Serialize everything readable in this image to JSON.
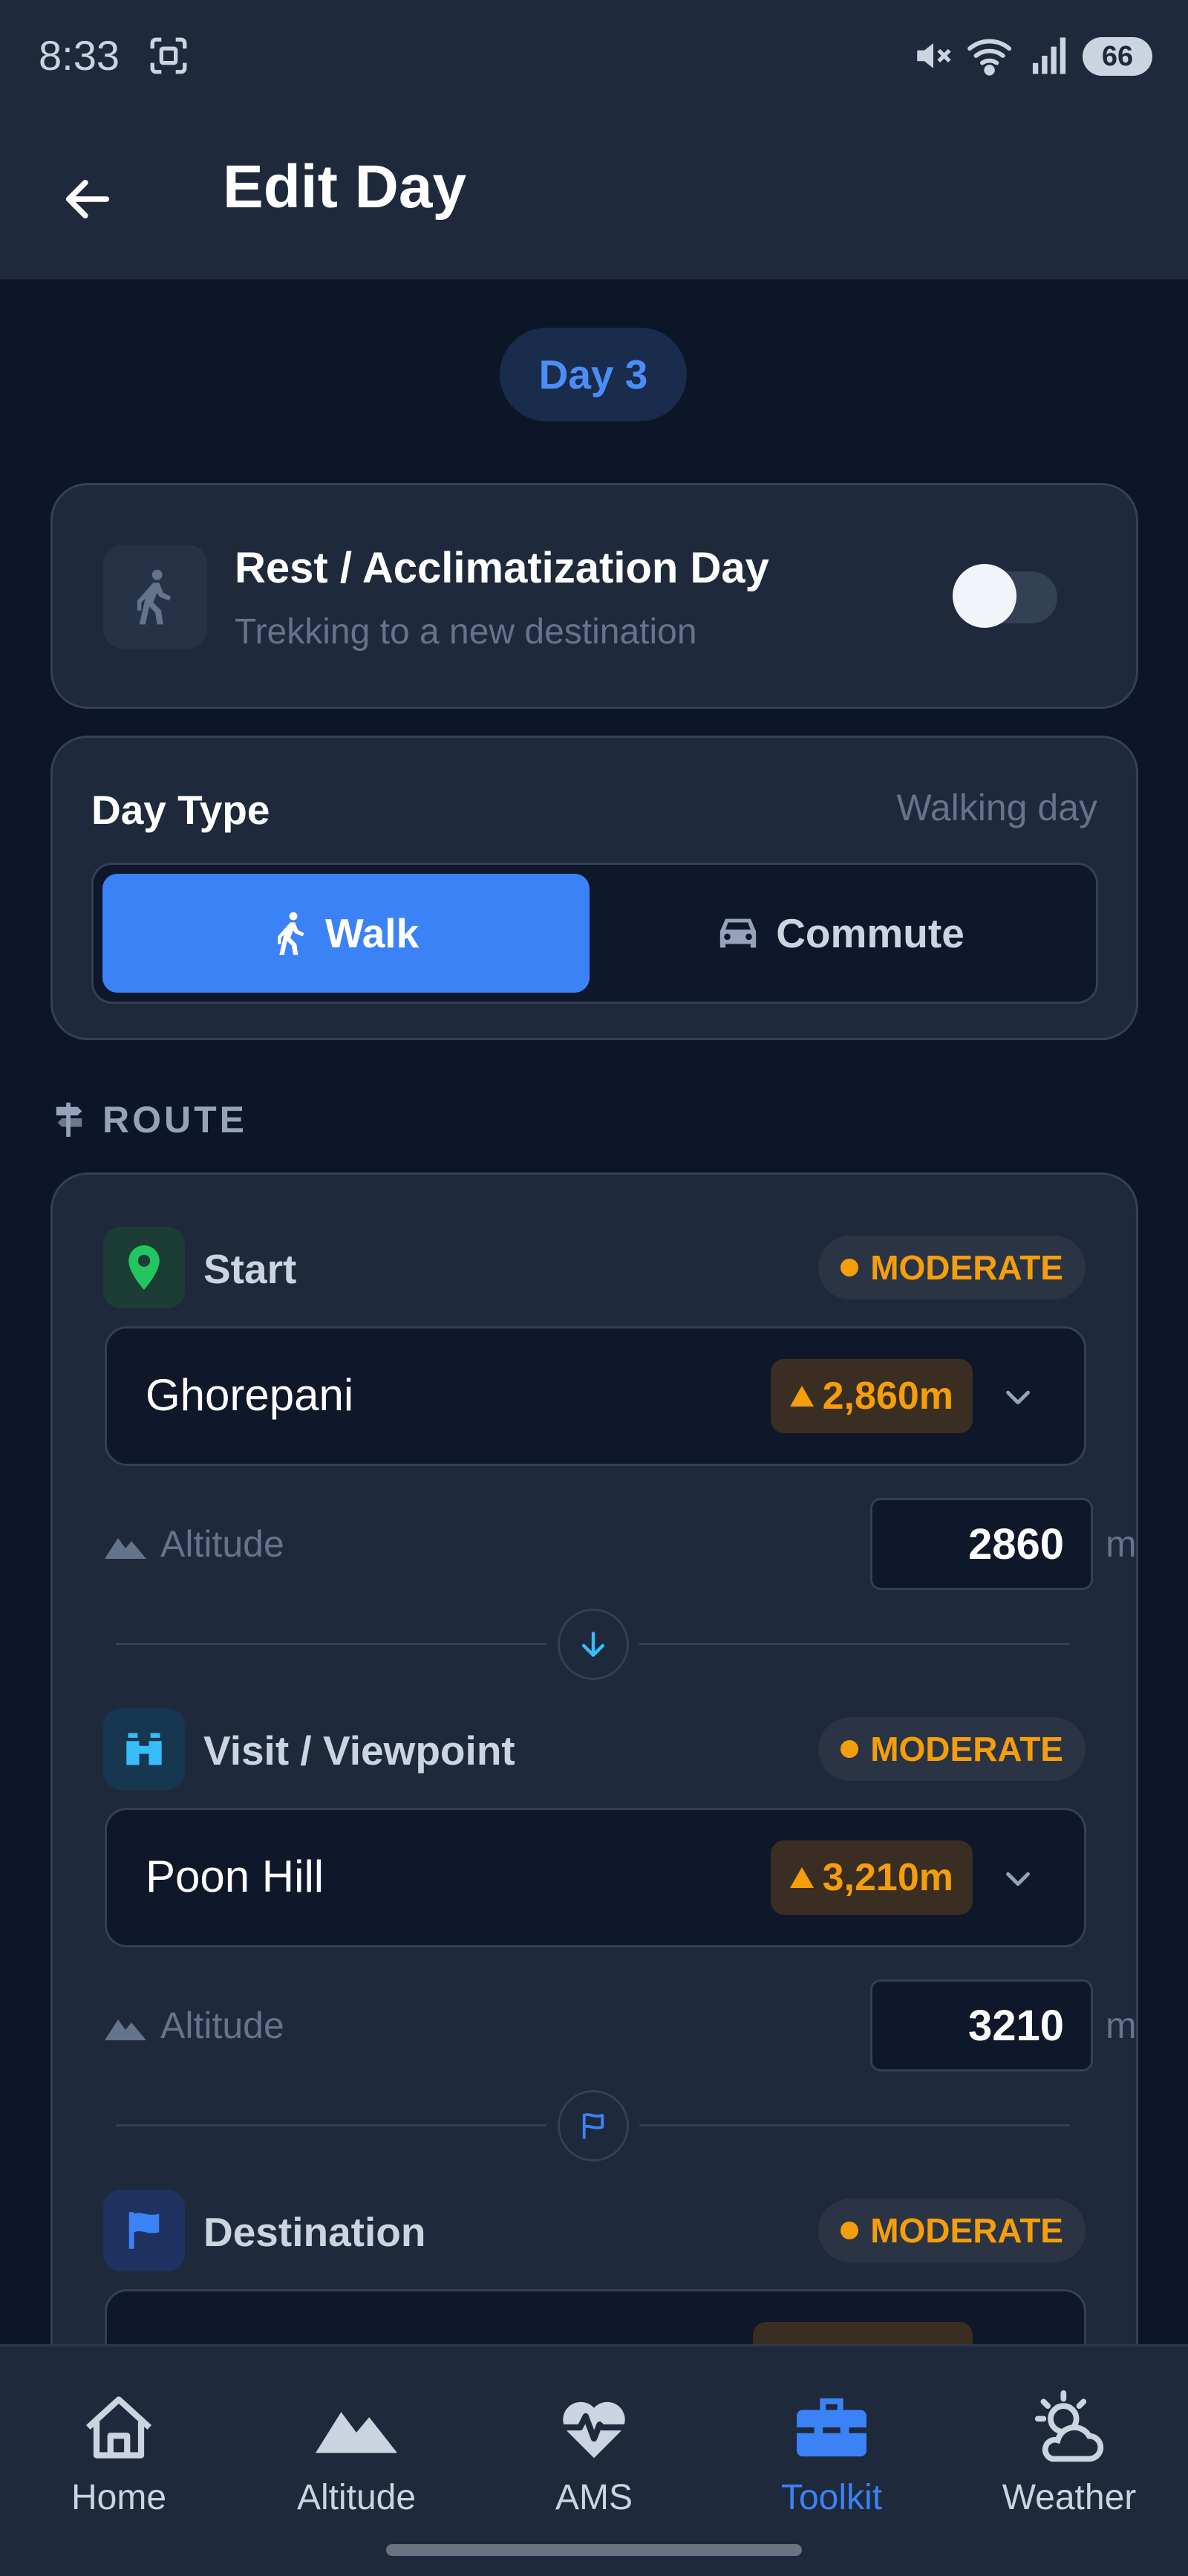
{
  "status_bar": {
    "time": "8:33",
    "battery": "66"
  },
  "header": {
    "title": "Edit Day"
  },
  "day_pill": "Day 3",
  "rest_card": {
    "title": "Rest / Acclimatization Day",
    "subtitle": "Trekking to a new destination",
    "enabled": false
  },
  "day_type": {
    "label": "Day Type",
    "value": "Walking day",
    "options": [
      {
        "label": "Walk",
        "selected": true
      },
      {
        "label": "Commute",
        "selected": false
      }
    ]
  },
  "route": {
    "heading": "ROUTE",
    "stops": [
      {
        "label": "Start",
        "difficulty": "MODERATE",
        "location": "Ghorepani",
        "altitude_chip": "2,860m",
        "altitude_label": "Altitude",
        "altitude_value": "2860",
        "unit": "m"
      },
      {
        "label": "Visit / Viewpoint",
        "difficulty": "MODERATE",
        "location": "Poon Hill",
        "altitude_chip": "3,210m",
        "altitude_label": "Altitude",
        "altitude_value": "3210",
        "unit": "m"
      },
      {
        "label": "Destination",
        "difficulty": "MODERATE"
      }
    ]
  },
  "bottom_nav": [
    {
      "label": "Home",
      "icon": "home-icon",
      "active": false
    },
    {
      "label": "Altitude",
      "icon": "mountain-icon",
      "active": false
    },
    {
      "label": "AMS",
      "icon": "heartbeat-icon",
      "active": false
    },
    {
      "label": "Toolkit",
      "icon": "toolbox-icon",
      "active": true
    },
    {
      "label": "Weather",
      "icon": "weather-icon",
      "active": false
    }
  ],
  "colors": {
    "background": "#0d1628",
    "surface": "#1e293b",
    "accent": "#3b82f6",
    "warning": "#f59e0b",
    "success": "#22c55e"
  }
}
